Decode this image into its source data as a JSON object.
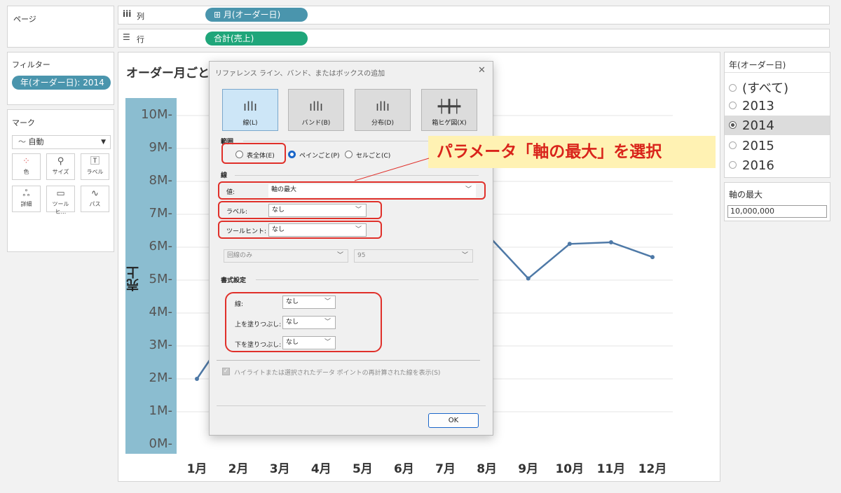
{
  "shelves": {
    "pages_label": "ページ",
    "columns_label": "列",
    "columns_pill": "⊞ 月(オーダー日)",
    "rows_label": "行",
    "rows_pill": "合計(売上)"
  },
  "filters": {
    "title": "フィルター",
    "pill": "年(オーダー日): 2014"
  },
  "marks": {
    "title": "マーク",
    "type": "自動",
    "buttons": [
      {
        "label": "色",
        "icon": "color-icon"
      },
      {
        "label": "サイズ",
        "icon": "size-icon"
      },
      {
        "label": "ラベル",
        "icon": "label-icon"
      },
      {
        "label": "詳細",
        "icon": "detail-icon"
      },
      {
        "label": "ツールヒ...",
        "icon": "tooltip-icon"
      },
      {
        "label": "パス",
        "icon": "path-icon"
      }
    ]
  },
  "chart": {
    "title": "オーダー月ごとの",
    "ylabel": "売上"
  },
  "chart_data": {
    "type": "line",
    "title": "オーダー月ごとの",
    "ylabel": "売上",
    "xlabel": "",
    "y_ticks": [
      "10M",
      "9M",
      "8M",
      "7M",
      "6M",
      "5M",
      "4M",
      "3M",
      "2M",
      "1M",
      "0M"
    ],
    "categories": [
      "1月",
      "2月",
      "3月",
      "4月",
      "5月",
      "6月",
      "7月",
      "8月",
      "9月",
      "10月",
      "11月",
      "12月"
    ],
    "visible_points": [
      {
        "x": "1月",
        "y": 2.0
      },
      {
        "x": "8月",
        "y": 6.4
      },
      {
        "x": "9月",
        "y": 5.05
      },
      {
        "x": "10月",
        "y": 6.1
      },
      {
        "x": "11月",
        "y": 6.15
      },
      {
        "x": "12月",
        "y": 5.7
      }
    ],
    "ylim": [
      0,
      10
    ],
    "grid": true,
    "line_color": "#4e79a7"
  },
  "year_filter": {
    "title": "年(オーダー日)",
    "options": [
      "(すべて)",
      "2013",
      "2014",
      "2015",
      "2016"
    ],
    "selected": "2014"
  },
  "axis_param": {
    "title": "軸の最大",
    "value": "10,000,000"
  },
  "dialog": {
    "title": "リファレンス ライン、バンド、またはボックスの追加",
    "close": "✕",
    "type_buttons": [
      "線(L)",
      "バンド(B)",
      "分布(D)",
      "箱ヒゲ図(X)"
    ],
    "scope_title": "範囲",
    "scope_options": [
      "表全体(E)",
      "ペインごと(P)",
      "セルごと(C)"
    ],
    "line_title": "線",
    "value_label": "値:",
    "value_selected": "軸の最大",
    "label_label": "ラベル:",
    "label_selected": "なし",
    "tooltip_label": "ツールヒント:",
    "tooltip_selected": "なし",
    "line_only": "回線のみ",
    "confidence": "95",
    "format_title": "書式設定",
    "format_line_label": "線:",
    "format_line_value": "なし",
    "fill_above_label": "上を塗りつぶし:",
    "fill_above_value": "なし",
    "fill_below_label": "下を塗りつぶし:",
    "fill_below_value": "なし",
    "recalc_checkbox": "ハイライトまたは選択されたデータ ポイントの再計算された線を表示(S)",
    "ok": "OK"
  },
  "annotation": {
    "text": "パラメータ「軸の最大」を選択"
  }
}
